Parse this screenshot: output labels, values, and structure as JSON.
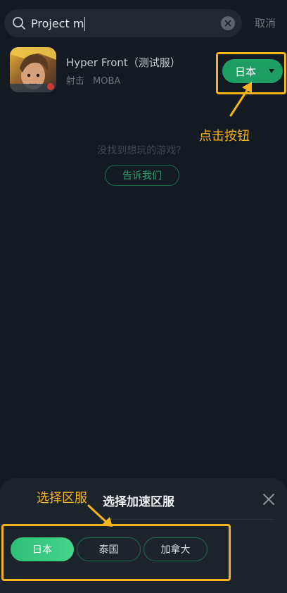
{
  "search": {
    "query": "Project m",
    "cancel_label": "取消"
  },
  "game": {
    "title": "Hyper Front（测试服）",
    "tags": [
      "射击",
      "MOBA"
    ],
    "selected_region": "日本"
  },
  "annotations": {
    "click_button": "点击按钮",
    "select_region": "选择区服"
  },
  "empty_state": {
    "message": "没找到想玩的游戏?",
    "tell_us_label": "告诉我们"
  },
  "sheet": {
    "title": "选择加速区服",
    "regions": [
      {
        "label": "日本",
        "active": true
      },
      {
        "label": "泰国",
        "active": false
      },
      {
        "label": "加拿大",
        "active": false
      }
    ]
  },
  "colors": {
    "background": "#141a22",
    "accent": "#1e9e64",
    "annotation": "#f6b41b"
  },
  "icons": [
    "search-icon",
    "clear-icon",
    "close-icon",
    "caret-down-icon",
    "arrow-icon"
  ]
}
